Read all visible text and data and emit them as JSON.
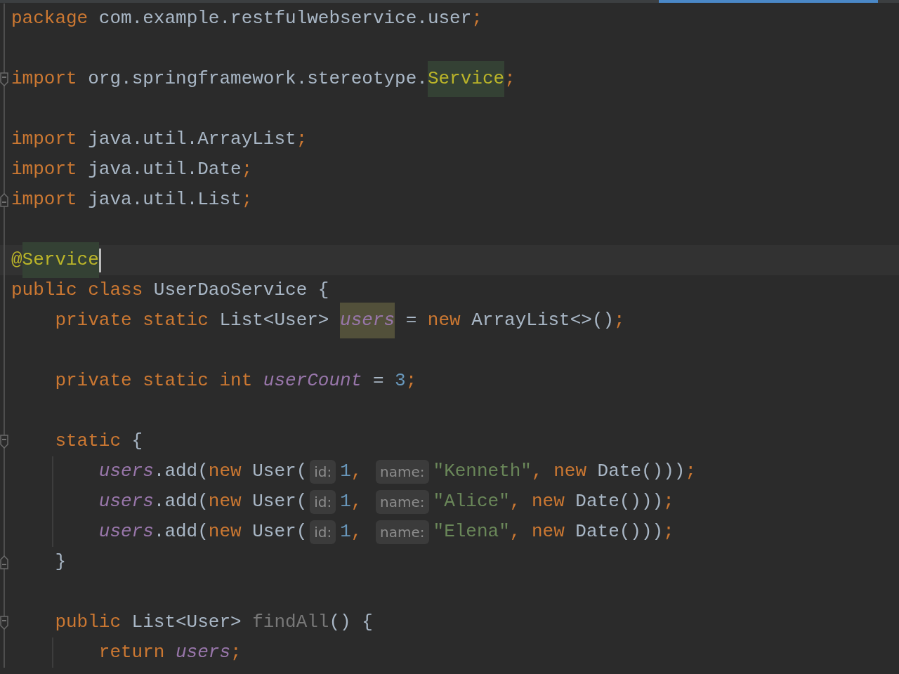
{
  "lines": [
    {
      "kind": "code",
      "tokens": [
        {
          "kind": "keyword",
          "text": "package"
        },
        {
          "kind": "plain",
          "text": " com.example.restfulwebservice.user"
        },
        {
          "kind": "keyword",
          "text": ";"
        }
      ]
    },
    {
      "kind": "blank"
    },
    {
      "kind": "code",
      "fold_start": true,
      "tokens": [
        {
          "kind": "keyword",
          "text": "import"
        },
        {
          "kind": "plain",
          "text": " org.springframework.stereotype."
        },
        {
          "kind": "annotation",
          "text": "Service",
          "highlighted": true
        },
        {
          "kind": "keyword",
          "text": ";"
        }
      ]
    },
    {
      "kind": "blank"
    },
    {
      "kind": "code",
      "tokens": [
        {
          "kind": "keyword",
          "text": "import"
        },
        {
          "kind": "plain",
          "text": " java.util.ArrayList"
        },
        {
          "kind": "keyword",
          "text": ";"
        }
      ]
    },
    {
      "kind": "code",
      "tokens": [
        {
          "kind": "keyword",
          "text": "import"
        },
        {
          "kind": "plain",
          "text": " java.util.Date"
        },
        {
          "kind": "keyword",
          "text": ";"
        }
      ]
    },
    {
      "kind": "code",
      "fold_end": true,
      "tokens": [
        {
          "kind": "keyword",
          "text": "import"
        },
        {
          "kind": "plain",
          "text": " java.util.List"
        },
        {
          "kind": "keyword",
          "text": ";"
        }
      ]
    },
    {
      "kind": "blank"
    },
    {
      "kind": "code",
      "current": true,
      "tokens": [
        {
          "kind": "annotation",
          "text": "@"
        },
        {
          "kind": "annotation",
          "text": "Service",
          "highlighted": true,
          "caret": true
        }
      ]
    },
    {
      "kind": "code",
      "tokens": [
        {
          "kind": "keyword",
          "text": "public class"
        },
        {
          "kind": "plain",
          "text": " UserDaoService {"
        }
      ]
    },
    {
      "kind": "code",
      "tokens": [
        {
          "kind": "keyword",
          "text": "    private static"
        },
        {
          "kind": "plain",
          "text": " List<User> "
        },
        {
          "kind": "field",
          "text": "users",
          "highlighted": true
        },
        {
          "kind": "plain",
          "text": " = "
        },
        {
          "kind": "keyword",
          "text": "new"
        },
        {
          "kind": "plain",
          "text": " ArrayList<>()"
        },
        {
          "kind": "keyword",
          "text": ";"
        }
      ]
    },
    {
      "kind": "blank"
    },
    {
      "kind": "code",
      "tokens": [
        {
          "kind": "keyword",
          "text": "    private static int"
        },
        {
          "kind": "field",
          "text": " userCount"
        },
        {
          "kind": "plain",
          "text": " = "
        },
        {
          "kind": "number",
          "text": "3"
        },
        {
          "kind": "keyword",
          "text": ";"
        }
      ]
    },
    {
      "kind": "blank"
    },
    {
      "kind": "code",
      "fold_start": true,
      "tokens": [
        {
          "kind": "keyword",
          "text": "    static"
        },
        {
          "kind": "plain",
          "text": " {"
        }
      ]
    },
    {
      "kind": "code",
      "guide": true,
      "tokens": [
        {
          "kind": "field",
          "text": "        users"
        },
        {
          "kind": "plain",
          "text": ".add("
        },
        {
          "kind": "keyword",
          "text": "new"
        },
        {
          "kind": "plain",
          "text": " User("
        },
        {
          "kind": "hint",
          "text": "id:"
        },
        {
          "kind": "number",
          "text": "1"
        },
        {
          "kind": "keyword",
          "text": ", "
        },
        {
          "kind": "hint",
          "text": "name:"
        },
        {
          "kind": "string",
          "text": "\"Kenneth\""
        },
        {
          "kind": "keyword",
          "text": ", new"
        },
        {
          "kind": "plain",
          "text": " Date()))"
        },
        {
          "kind": "keyword",
          "text": ";"
        }
      ]
    },
    {
      "kind": "code",
      "guide": true,
      "tokens": [
        {
          "kind": "field",
          "text": "        users"
        },
        {
          "kind": "plain",
          "text": ".add("
        },
        {
          "kind": "keyword",
          "text": "new"
        },
        {
          "kind": "plain",
          "text": " User("
        },
        {
          "kind": "hint",
          "text": "id:"
        },
        {
          "kind": "number",
          "text": "1"
        },
        {
          "kind": "keyword",
          "text": ", "
        },
        {
          "kind": "hint",
          "text": "name:"
        },
        {
          "kind": "string",
          "text": "\"Alice\""
        },
        {
          "kind": "keyword",
          "text": ", new"
        },
        {
          "kind": "plain",
          "text": " Date()))"
        },
        {
          "kind": "keyword",
          "text": ";"
        }
      ]
    },
    {
      "kind": "code",
      "guide": true,
      "tokens": [
        {
          "kind": "field",
          "text": "        users"
        },
        {
          "kind": "plain",
          "text": ".add("
        },
        {
          "kind": "keyword",
          "text": "new"
        },
        {
          "kind": "plain",
          "text": " User("
        },
        {
          "kind": "hint",
          "text": "id:"
        },
        {
          "kind": "number",
          "text": "1"
        },
        {
          "kind": "keyword",
          "text": ", "
        },
        {
          "kind": "hint",
          "text": "name:"
        },
        {
          "kind": "string",
          "text": "\"Elena\""
        },
        {
          "kind": "keyword",
          "text": ", new"
        },
        {
          "kind": "plain",
          "text": " Date()))"
        },
        {
          "kind": "keyword",
          "text": ";"
        }
      ]
    },
    {
      "kind": "code",
      "fold_end": true,
      "tokens": [
        {
          "kind": "plain",
          "text": "    }"
        }
      ]
    },
    {
      "kind": "blank"
    },
    {
      "kind": "code",
      "fold_start": true,
      "tokens": [
        {
          "kind": "keyword",
          "text": "    public"
        },
        {
          "kind": "plain",
          "text": " List<User> "
        },
        {
          "kind": "unused",
          "text": "findAll"
        },
        {
          "kind": "plain",
          "text": "() {"
        }
      ]
    },
    {
      "kind": "code",
      "guide": true,
      "tokens": [
        {
          "kind": "keyword",
          "text": "        return"
        },
        {
          "kind": "field",
          "text": " users"
        },
        {
          "kind": "keyword",
          "text": ";"
        }
      ]
    }
  ]
}
